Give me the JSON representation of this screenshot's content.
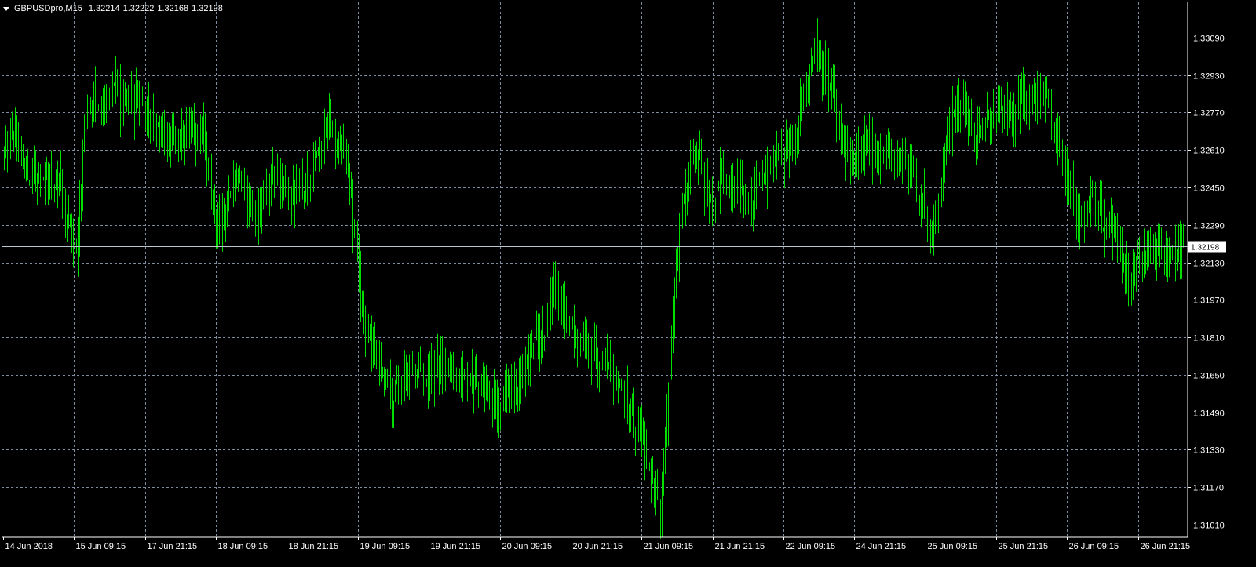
{
  "window": {
    "symbol": "GBPUSDpro,M15",
    "open": "1.32214",
    "high": "1.32222",
    "low": "1.32168",
    "close": "1.32198"
  },
  "colors": {
    "background": "#000000",
    "grid": "#7f8da0",
    "axis": "#ffffff",
    "bars": "#00e000",
    "current_price_line": "#b8c4d0",
    "price_tag_bg": "#ffffff"
  },
  "chart_data": {
    "type": "line",
    "style": "ohlc-bars",
    "timeframe": "M15",
    "symbol": "GBPUSDpro",
    "current_price": 1.32198,
    "current_price_label": "1.32198",
    "ylim": [
      1.3096,
      1.3324
    ],
    "grid": true,
    "y_ticks": [
      "1.33090",
      "1.32930",
      "1.32770",
      "1.32610",
      "1.32450",
      "1.32290",
      "1.32130",
      "1.31970",
      "1.31810",
      "1.31650",
      "1.31490",
      "1.31330",
      "1.31170",
      "1.31010"
    ],
    "x_ticks": [
      "14 Jun 2018",
      "15 Jun 09:15",
      "17 Jun 21:15",
      "18 Jun 09:15",
      "18 Jun 21:15",
      "19 Jun 09:15",
      "19 Jun 21:15",
      "20 Jun 09:15",
      "20 Jun 21:15",
      "21 Jun 09:15",
      "21 Jun 21:15",
      "22 Jun 09:15",
      "24 Jun 21:15",
      "25 Jun 09:15",
      "25 Jun 21:15",
      "26 Jun 09:15",
      "26 Jun 21:15"
    ],
    "series": [
      {
        "values": [
          1.3259,
          1.3268,
          1.3255,
          1.3248,
          1.3252,
          1.3245,
          1.325,
          1.323,
          1.3215,
          1.3275,
          1.3285,
          1.328,
          1.329,
          1.3282,
          1.3278,
          1.3283,
          1.3276,
          1.327,
          1.3268,
          1.3265,
          1.327,
          1.3266,
          1.327,
          1.324,
          1.3225,
          1.3245,
          1.325,
          1.324,
          1.3235,
          1.3242,
          1.325,
          1.3245,
          1.324,
          1.3244,
          1.325,
          1.3262,
          1.327,
          1.3265,
          1.3258,
          1.322,
          1.3185,
          1.3175,
          1.3165,
          1.3155,
          1.316,
          1.3165,
          1.317,
          1.3163,
          1.3168,
          1.317,
          1.3165,
          1.3162,
          1.316,
          1.3158,
          1.3155,
          1.3152,
          1.3158,
          1.3155,
          1.317,
          1.3185,
          1.3175,
          1.3205,
          1.3195,
          1.3185,
          1.318,
          1.3175,
          1.3172,
          1.317,
          1.3165,
          1.3155,
          1.3145,
          1.3135,
          1.312,
          1.3105,
          1.3175,
          1.3225,
          1.325,
          1.326,
          1.3245,
          1.3242,
          1.3252,
          1.3245,
          1.324,
          1.3238,
          1.3245,
          1.3255,
          1.326,
          1.3262,
          1.327,
          1.3285,
          1.3305,
          1.3295,
          1.329,
          1.3265,
          1.3255,
          1.326,
          1.3263,
          1.3258,
          1.326,
          1.3255,
          1.3258,
          1.3248,
          1.3238,
          1.3225,
          1.3245,
          1.327,
          1.328,
          1.3275,
          1.3265,
          1.327,
          1.3275,
          1.328,
          1.3276,
          1.328,
          1.3284,
          1.3286,
          1.3282,
          1.327,
          1.325,
          1.3235,
          1.323,
          1.324,
          1.3232,
          1.323,
          1.322,
          1.3205,
          1.3215,
          1.3218,
          1.322,
          1.3215,
          1.322,
          1.3219
        ]
      }
    ]
  }
}
